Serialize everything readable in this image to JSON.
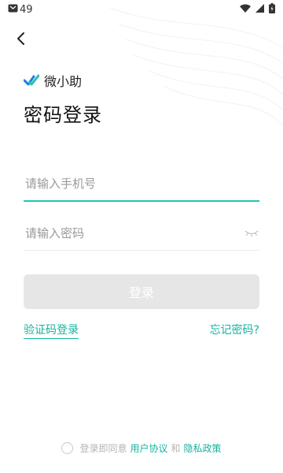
{
  "status_bar": {
    "time": "49"
  },
  "brand": {
    "name": "微小助"
  },
  "page": {
    "title": "密码登录"
  },
  "form": {
    "phone_placeholder": "请输入手机号",
    "password_placeholder": "请输入密码",
    "login_label": "登录"
  },
  "links": {
    "sms_login": "验证码登录",
    "forgot_password": "忘记密码?"
  },
  "agreement": {
    "prefix": "登录即同意",
    "user_agreement": "用户协议",
    "and": "和",
    "privacy_policy": "隐私政策"
  },
  "colors": {
    "accent": "#16b39f",
    "button_disabled": "#e6e6e6"
  }
}
